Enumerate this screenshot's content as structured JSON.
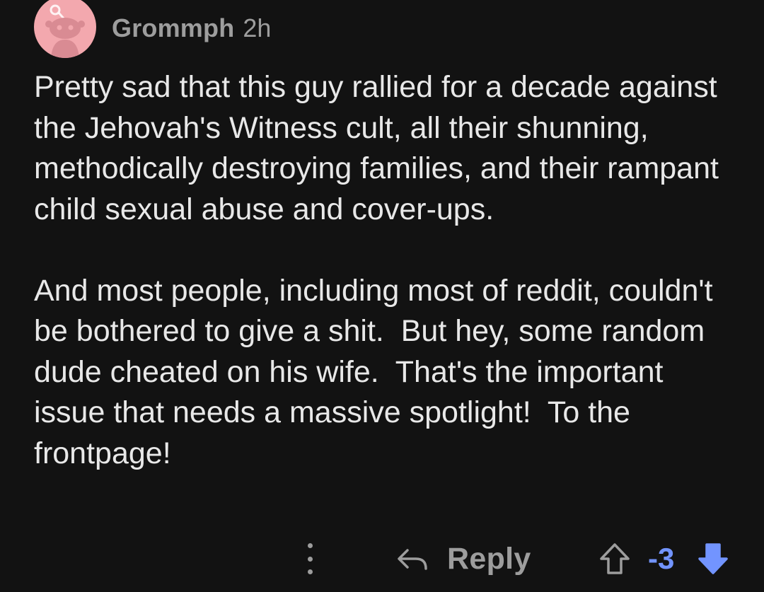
{
  "comment": {
    "author": "Grommph",
    "time": "2h",
    "paragraphs": [
      "Pretty sad that this guy rallied for a decade against the Jehovah's Witness cult, all their shunning, methodically destroying families, and their rampant child sexual abuse and cover-ups.",
      "And most people, including most of reddit, couldn't be bothered to give a shit.  But hey, some random dude cheated on his wife.  That's the important issue that needs a massive spotlight!  To the frontpage!"
    ]
  },
  "actions": {
    "more_icon": "vertical-ellipsis-icon",
    "reply_icon": "reply-arrow-icon",
    "reply_label": "Reply",
    "upvote_icon": "upvote-arrow-icon",
    "score": "-3",
    "downvote_icon": "downvote-arrow-icon",
    "downvote_active": true
  },
  "colors": {
    "background": "#121212",
    "text": "#e8e8e8",
    "muted": "#9d9d9d",
    "avatar_bg": "#f3a8ae",
    "downvote": "#7294ff"
  }
}
